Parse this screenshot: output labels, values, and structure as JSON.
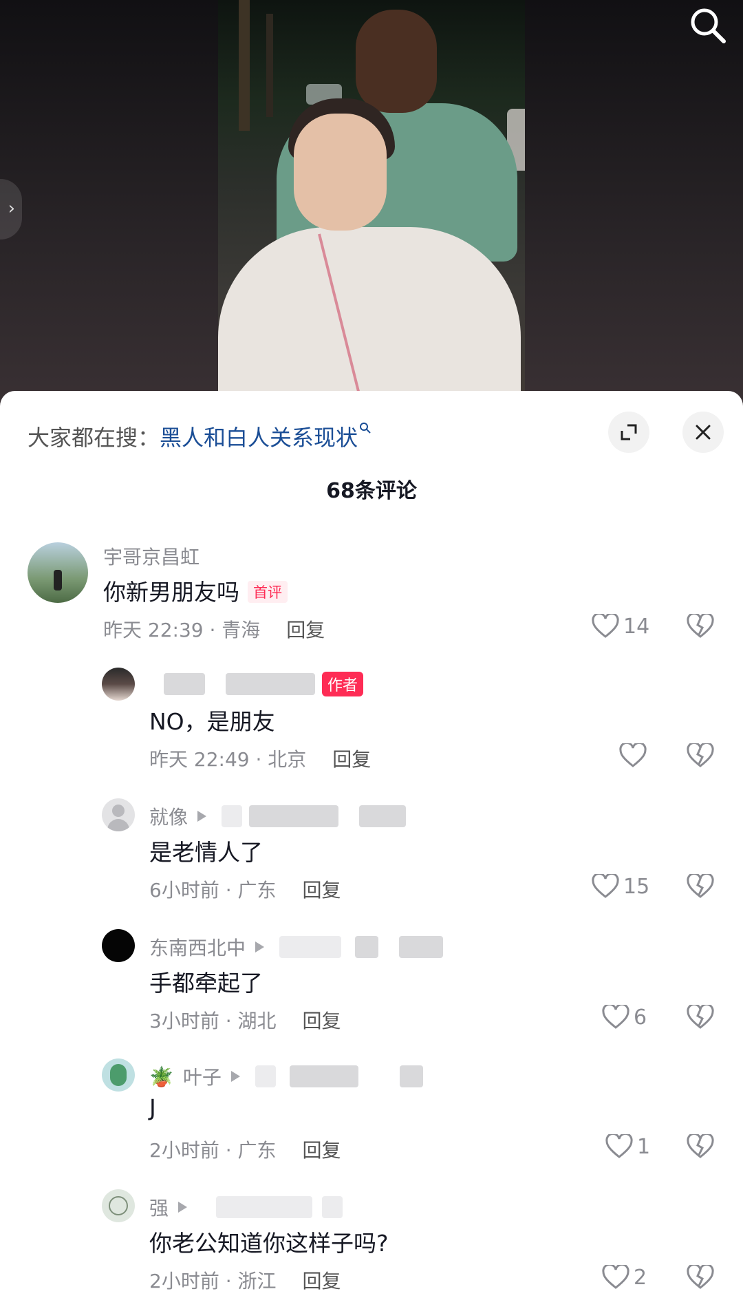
{
  "sheet": {
    "search_prefix": "大家都在搜：",
    "search_term": "黑人和白人关系现状",
    "comment_count_label": "68条评论"
  },
  "comments": [
    {
      "username": "宇哥京昌虹",
      "text": "你新男朋友吗",
      "badge": "首评",
      "time_location": "昨天 22:39 · 青海",
      "reply": "回复",
      "likes": "14"
    },
    {
      "username": "",
      "text": "NO，是朋友",
      "badge": "作者",
      "time_location": "昨天 22:49 · 北京",
      "reply": "回复",
      "likes": ""
    },
    {
      "username": "就像",
      "text": "是老情人了",
      "time_location": "6小时前 · 广东",
      "reply": "回复",
      "likes": "15"
    },
    {
      "username": "东南西北中",
      "text": "手都牵起了",
      "time_location": "3小时前 · 湖北",
      "reply": "回复",
      "likes": "6"
    },
    {
      "username": "叶子",
      "username_emoji": "🪴",
      "text": "J",
      "time_location": "2小时前 · 广东",
      "reply": "回复",
      "likes": "1"
    },
    {
      "username": "强",
      "text": "你老公知道你这样子吗?",
      "time_location": "2小时前 · 浙江",
      "reply": "回复",
      "likes": "2"
    }
  ],
  "icons": {
    "search": "search-icon",
    "expand": "expand-icon",
    "close": "close-icon",
    "like": "heart-icon",
    "dislike": "broken-heart-icon"
  },
  "colors": {
    "accent_red": "#fe2c55",
    "search_term_blue": "#1b4e96",
    "secondary_text": "#8a8b91"
  }
}
